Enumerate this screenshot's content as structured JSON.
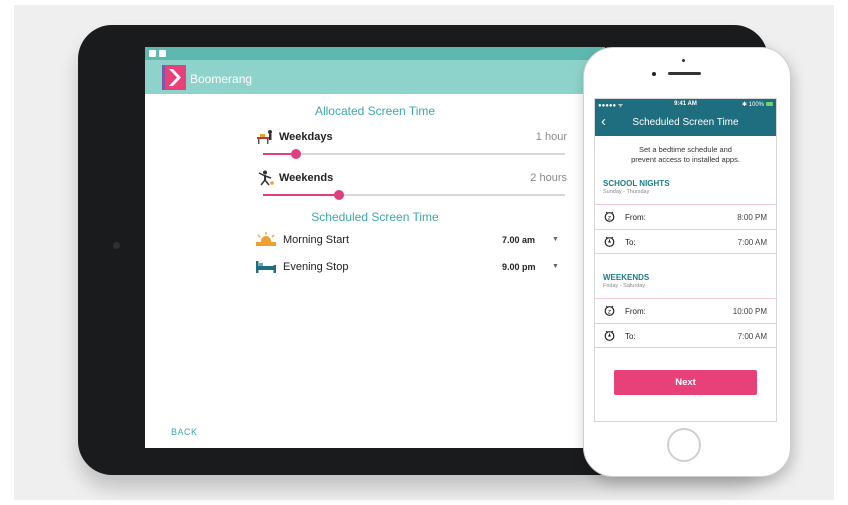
{
  "tablet": {
    "app_title": "Boomerang",
    "allocated_title": "Allocated Screen Time",
    "allocated_rows": [
      {
        "label": "Weekdays",
        "value": "1 hour",
        "level": 0.11
      },
      {
        "label": "Weekends",
        "value": "2 hours",
        "level": 0.25
      }
    ],
    "scheduled_title": "Scheduled Screen Time",
    "scheduled_rows": [
      {
        "label": "Morning Start",
        "value": "7.00 am",
        "icon": "sunrise-icon"
      },
      {
        "label": "Evening Stop",
        "value": "9.00 pm",
        "icon": "bed-icon"
      }
    ],
    "back_label": "BACK"
  },
  "phone": {
    "status": {
      "signal": "●●●●● ᯤ",
      "time": "9:41 AM",
      "battery": "✱ 100%"
    },
    "title": "Scheduled Screen Time",
    "intro_line1": "Set a bedtime schedule and",
    "intro_line2": "prevent access to installed apps.",
    "sections": [
      {
        "title": "SCHOOL NIGHTS",
        "subtitle": "Sunday - Thursday",
        "rows": [
          {
            "label": "From:",
            "value": "8:00 PM",
            "icon": "sleep-clock-icon"
          },
          {
            "label": "To:",
            "value": "7:00 AM",
            "icon": "alarm-clock-icon"
          }
        ]
      },
      {
        "title": "WEEKENDS",
        "subtitle": "Friday - Saturday",
        "rows": [
          {
            "label": "From:",
            "value": "10:00 PM",
            "icon": "sleep-clock-icon"
          },
          {
            "label": "To:",
            "value": "7:00 AM",
            "icon": "alarm-clock-icon"
          }
        ]
      }
    ],
    "next_label": "Next"
  },
  "colors": {
    "teal_header": "#8ed3cb",
    "teal_text": "#3fa7a6",
    "phone_header": "#1e6e7f",
    "accent_pink": "#e03e7e",
    "button_pink": "#e8417a"
  }
}
